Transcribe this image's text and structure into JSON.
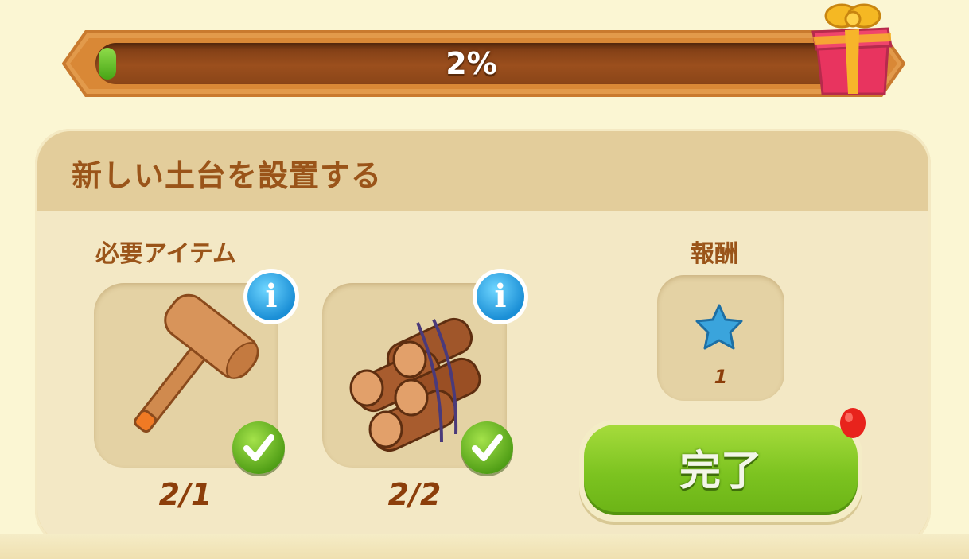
{
  "progress": {
    "percent_label": "2%",
    "fill_fraction": 0.02
  },
  "quest": {
    "title": "新しい土台を設置する",
    "required_label": "必要アイテム",
    "reward_label": "報酬",
    "items": [
      {
        "icon": "mallet-icon",
        "count": "2/1",
        "complete": true
      },
      {
        "icon": "logs-icon",
        "count": "2/2",
        "complete": true
      }
    ],
    "reward": {
      "icon": "blue-star-icon",
      "count": "1"
    },
    "complete_button": "完了"
  },
  "colors": {
    "background": "#fbf6d3",
    "title_brown": "#9a5419",
    "count_brown": "#8c3e0a",
    "button_green": "#7cc320",
    "info_blue": "#1b8fd6"
  }
}
